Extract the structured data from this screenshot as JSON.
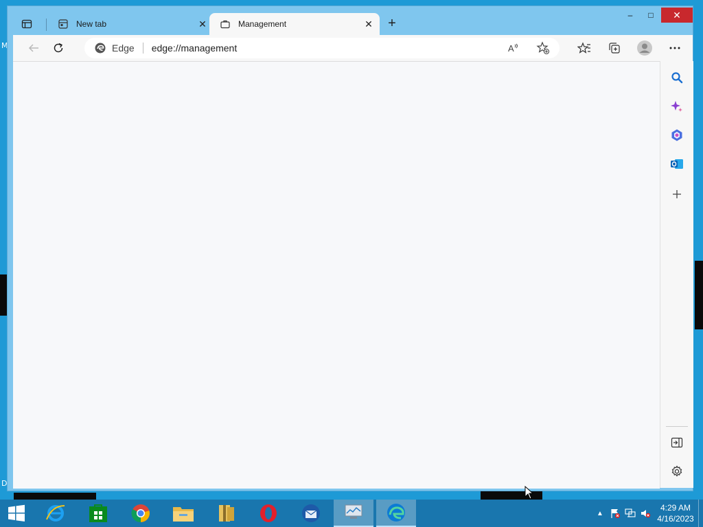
{
  "desktop": {
    "edge_letters": [
      "M",
      "D"
    ]
  },
  "window": {
    "controls": {
      "minimize": "–",
      "maximize": "□",
      "close": "✕"
    }
  },
  "tabs": [
    {
      "title": "New tab",
      "icon": "new-tab-page-icon",
      "close": "✕",
      "active": false
    },
    {
      "title": "Management",
      "icon": "briefcase-icon",
      "close": "✕",
      "active": true
    }
  ],
  "new_tab_symbol": "+",
  "address_bar": {
    "site_label": "Edge",
    "url": "edge://management"
  },
  "taskbar": {
    "apps": [
      "start-button",
      "internet-explorer",
      "microsoft-store",
      "google-chrome",
      "file-explorer",
      "archive-app",
      "opera",
      "thunderbird",
      "system-monitor",
      "microsoft-edge"
    ],
    "clock_time": "4:29 AM",
    "clock_date": "4/16/2023",
    "tray_overflow": "▲"
  }
}
